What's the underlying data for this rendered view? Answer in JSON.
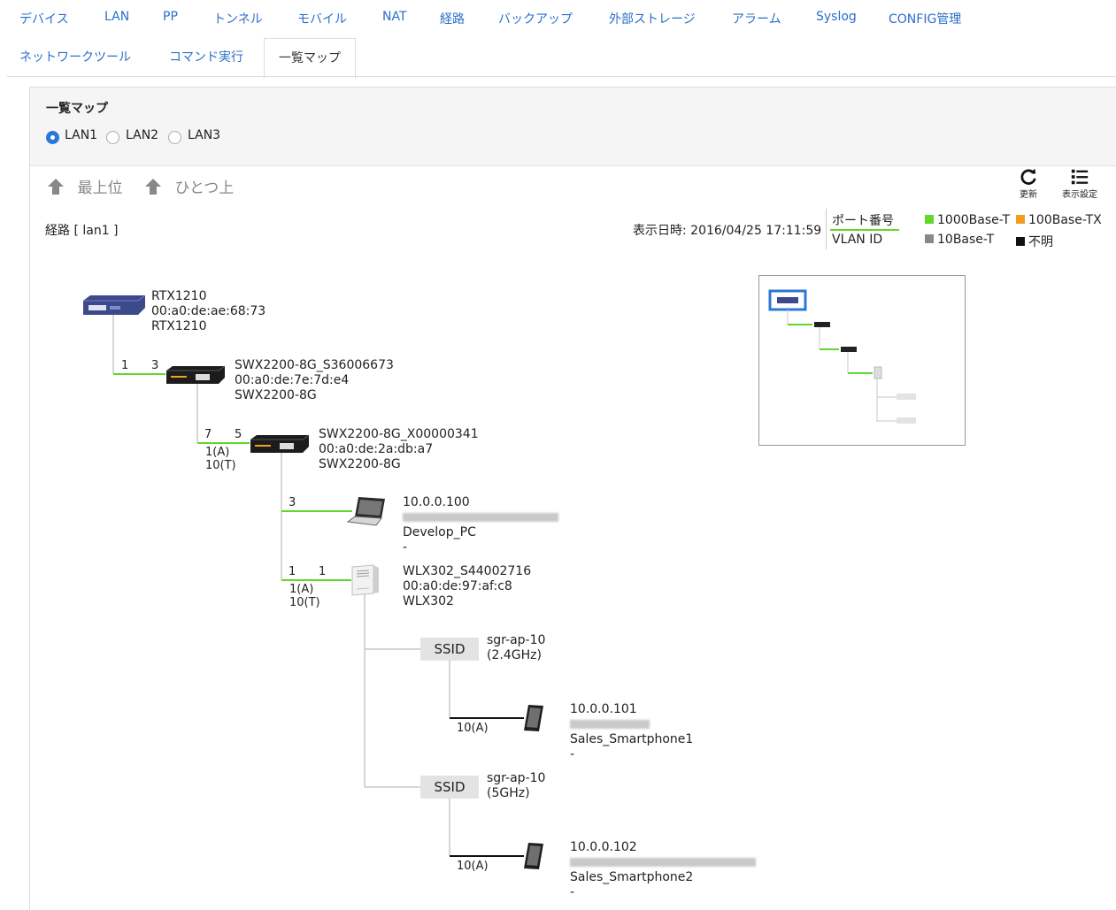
{
  "tabs": {
    "row1": [
      "デバイス",
      "LAN",
      "PP",
      "トンネル",
      "モバイル",
      "NAT",
      "経路",
      "バックアップ",
      "外部ストレージ",
      "アラーム",
      "Syslog",
      "CONFIG管理"
    ],
    "row2": [
      "ネットワークツール",
      "コマンド実行",
      "一覧マップ"
    ],
    "active": "一覧マップ"
  },
  "panel": {
    "title": "一覧マップ",
    "lans": [
      "LAN1",
      "LAN2",
      "LAN3"
    ],
    "selected_lan": "LAN1"
  },
  "toolbar": {
    "top_label": "最上位",
    "up_label": "ひとつ上",
    "refresh_label": "更新",
    "settings_label": "表示設定"
  },
  "route": "経路 [ lan1 ]",
  "display_time": "表示日時: 2016/04/25 17:11:59",
  "legend": {
    "port_label": "ポート番号",
    "vlan_label": "VLAN ID",
    "items": [
      {
        "label": "1000Base-T",
        "color": "#5fd82b"
      },
      {
        "label": "100Base-TX",
        "color": "#f29b1d"
      },
      {
        "label": "10Base-T",
        "color": "#888888"
      },
      {
        "label": "不明",
        "color": "#111111"
      }
    ]
  },
  "devices": {
    "rtx": {
      "name": "RTX1210",
      "mac": "00:a0:de:ae:68:73",
      "model": "RTX1210"
    },
    "swx1": {
      "name": "SWX2200-8G_S36006673",
      "mac": "00:a0:de:7e:7d:e4",
      "model": "SWX2200-8G",
      "port_up": "1",
      "port_down": "3"
    },
    "swx2": {
      "name": "SWX2200-8G_X00000341",
      "mac": "00:a0:de:2a:db:a7",
      "model": "SWX2200-8G",
      "port_up": "7",
      "port_down": "5",
      "vlan1": "1(A)",
      "vlan2": "10(T)"
    },
    "pc": {
      "ip": "10.0.0.100",
      "name": "Develop_PC",
      "extra": "-",
      "port": "3"
    },
    "wlx": {
      "name": "WLX302_S44002716",
      "mac": "00:a0:de:97:af:c8",
      "model": "WLX302",
      "port_up": "1",
      "port_down": "1",
      "vlan1": "1(A)",
      "vlan2": "10(T)"
    },
    "ssid1": {
      "label": "SSID",
      "name": "sgr-ap-10",
      "band": "(2.4GHz)"
    },
    "ssid2": {
      "label": "SSID",
      "name": "sgr-ap-10",
      "band": "(5GHz)"
    },
    "phone1": {
      "ip": "10.0.0.101",
      "name": "Sales_Smartphone1",
      "extra": "-",
      "vlan": "10(A)"
    },
    "phone2": {
      "ip": "10.0.0.102",
      "name": "Sales_Smartphone2",
      "extra": "-",
      "vlan": "10(A)"
    }
  },
  "colors": {
    "accent": "#2a6fc9",
    "gigabit": "#5fd82b",
    "unknown": "#111111",
    "tree": "#c8c8c8"
  }
}
